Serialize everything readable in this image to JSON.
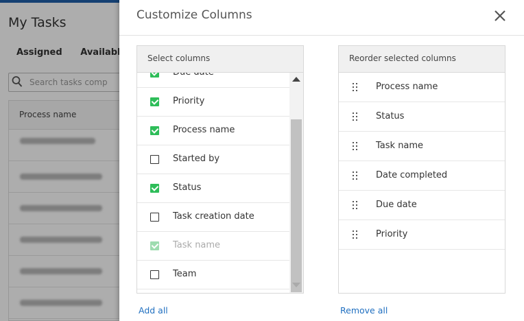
{
  "background": {
    "title": "My Tasks",
    "tabs": [
      "Assigned",
      "Available"
    ],
    "search_placeholder": "Search tasks comp",
    "table_header": "Process name"
  },
  "modal": {
    "title": "Customize Columns",
    "close_icon": "close-icon"
  },
  "select_columns": {
    "header": "Select columns",
    "items": [
      {
        "label": "Due date",
        "checked": true,
        "disabled": false
      },
      {
        "label": "Priority",
        "checked": true,
        "disabled": false
      },
      {
        "label": "Process name",
        "checked": true,
        "disabled": false
      },
      {
        "label": "Started by",
        "checked": false,
        "disabled": false
      },
      {
        "label": "Status",
        "checked": true,
        "disabled": false
      },
      {
        "label": "Task creation date",
        "checked": false,
        "disabled": false
      },
      {
        "label": "Task name",
        "checked": true,
        "disabled": true
      },
      {
        "label": "Team",
        "checked": false,
        "disabled": false
      }
    ],
    "add_all": "Add all"
  },
  "reorder_columns": {
    "header": "Reorder selected columns",
    "items": [
      "Process name",
      "Status",
      "Task name",
      "Date completed",
      "Due date",
      "Priority"
    ],
    "remove_all": "Remove all"
  },
  "colors": {
    "accent": "#1f6fc0",
    "checked": "#2ebd59",
    "checked_disabled": "#9edcb0",
    "topbar": "#1f5fa8"
  }
}
